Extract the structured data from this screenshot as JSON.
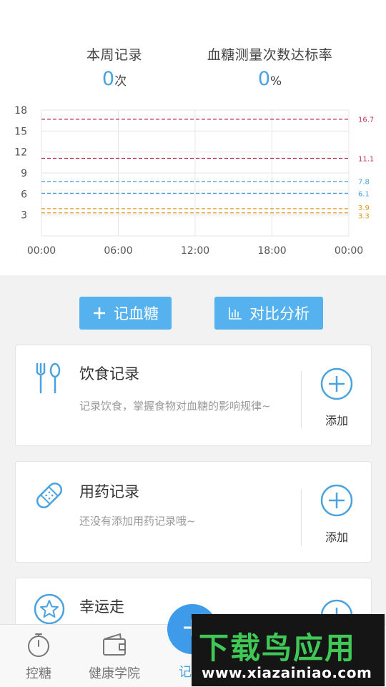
{
  "stats": {
    "weekly_label": "本周记录",
    "weekly_value": "0",
    "weekly_unit": "次",
    "rate_label": "血糖测量次数达标率",
    "rate_value": "0",
    "rate_unit": "%"
  },
  "chart_data": {
    "type": "line",
    "y_ticks": [
      "18",
      "15",
      "12",
      "9",
      "6",
      "3"
    ],
    "x_ticks": [
      "00:00",
      "06:00",
      "12:00",
      "18:00",
      "00:00"
    ],
    "ylim": [
      0,
      18
    ],
    "grid": true,
    "reference_lines": [
      {
        "value": 16.7,
        "label": "16.7",
        "color": "#c0304a"
      },
      {
        "value": 11.1,
        "label": "11.1",
        "color": "#c0304a"
      },
      {
        "value": 7.8,
        "label": "7.8",
        "color": "#4aa3df"
      },
      {
        "value": 6.1,
        "label": "6.1",
        "color": "#4aa3df"
      },
      {
        "value": 3.9,
        "label": "3.9",
        "color": "#e09a1a"
      },
      {
        "value": 3.3,
        "label": "3.3",
        "color": "#e09a1a"
      }
    ],
    "series": []
  },
  "actions": {
    "record_label": "记血糖",
    "analysis_label": "对比分析"
  },
  "cards": {
    "diet": {
      "title": "饮食记录",
      "desc": "记录饮食，掌握食物对血糖的影响规律~",
      "add_label": "添加"
    },
    "med": {
      "title": "用药记录",
      "desc": "还没有添加用药记录哦~",
      "add_label": "添加"
    },
    "walk": {
      "title": "幸运走"
    }
  },
  "nav": {
    "item1": "控糖",
    "item2": "健康学院",
    "item3": "记"
  },
  "watermark": {
    "title": "下载鸟应用",
    "url": "www.xiazainiao.com"
  },
  "colors": {
    "accent": "#4aa3df",
    "button": "#55b2ee",
    "fab": "#3d9be9",
    "watermark_green": "#40c857"
  }
}
